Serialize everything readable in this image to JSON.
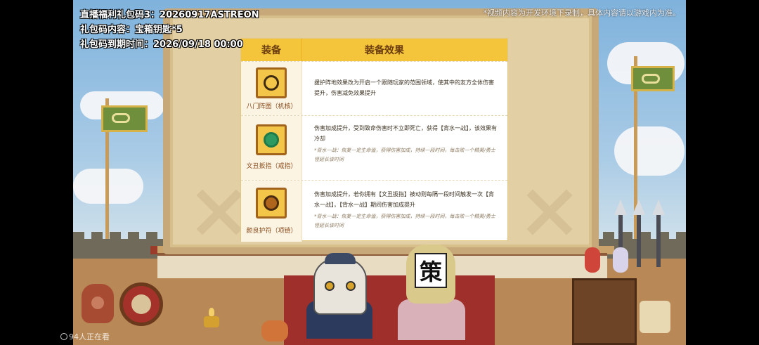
{
  "stream_overlay": {
    "gift_code_line": "直播福利礼包码3：20260917ASTREON",
    "gift_content_line": "礼包码内容：宝箱钥匙*5",
    "expiry_line": "礼包码到期时间：2026/09/18 00:00",
    "disclaimer": "*视频内容为开发环境下录制，具体内容请以游戏内为准。",
    "viewers": "94人正在看"
  },
  "equipment_table": {
    "header_equip": "装备",
    "header_effect": "装备效果",
    "rows": [
      {
        "icon": "eight-gates-core-icon",
        "name": "八门阵图（机核）",
        "effect": "援护阵地效果改为开启一个跟随玩家的范围领域，使其中的友方全体伤害提升，伤害减免效果提升",
        "note": ""
      },
      {
        "icon": "jade-ring-icon",
        "name": "文丑扳指（戒指）",
        "effect": "伤害加成提升，受到致命伤害时不立即死亡，获得【背水一战】，该效果有冷却",
        "note": "*背水一战：恢复一定生命值，获得伤害加成，持续一段时间，每击败一个精英/勇士怪延长该时间"
      },
      {
        "icon": "amulet-icon",
        "name": "颜良护符（项链）",
        "effect": "伤害加成提升，若你拥有【文丑扳指】被动则每隔一段时间触发一次【背水一战】，【背水一战】期间伤害加成提升",
        "note": "*背水一战：恢复一定生命值，获得伤害加成，持续一段时间，每击败一个精英/勇士怪延长该时间"
      }
    ]
  },
  "streamer_card_glyph": "策",
  "colors": {
    "header_bg": "#f4c53b",
    "header_text": "#6b3d10",
    "item_name": "#8a4b1c",
    "parchment": "#e2d0a4"
  }
}
